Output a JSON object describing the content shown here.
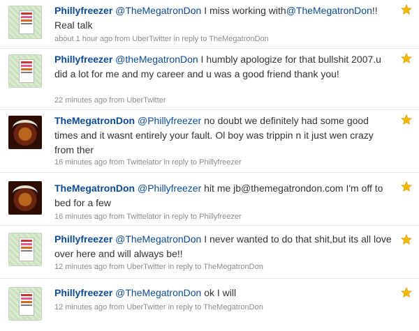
{
  "colors": {
    "link": "#0b4a94",
    "text": "#333333",
    "meta": "#8a8a8a",
    "star": "#f5b800"
  },
  "tweets": [
    {
      "user": "Phillyfreezer",
      "avatar": "phillyfreezer-avatar",
      "mention": "@TheMegatronDon",
      "text": " I miss working with",
      "mention2": "@TheMegatronDon",
      "text2": "!! Real talk",
      "time": "about 1 hour ago",
      "from": "from",
      "client": "UberTwitter",
      "reply_prefix": "in reply to",
      "reply_to": "TheMegatronDon"
    },
    {
      "user": "Phillyfreezer",
      "avatar": "phillyfreezer-avatar",
      "mention": "@theMegatronDon",
      "text": " I humbly apologize for that bullshit 2007.u did a lot for me and my career and u was a good friend thank you!",
      "time": "22 minutes ago",
      "from": "from",
      "client": "UberTwitter"
    },
    {
      "user": "TheMegatronDon",
      "avatar": "megatrondon-avatar",
      "mention": "@Phillyfreezer",
      "text": " no doubt we definitely had some good times and it wasnt entirely your fault. Ol boy was trippin n it just wen crazy from ther",
      "time": "16 minutes ago",
      "from": "from",
      "client": "Twittelator",
      "reply_prefix": "in reply to",
      "reply_to": "Phillyfreezer"
    },
    {
      "user": "TheMegatronDon",
      "avatar": "megatrondon-avatar",
      "mention": "@Phillyfreezer",
      "text": " hit me jb@themegatrondon.com I'm off to bed for a few",
      "time": "16 minutes ago",
      "from": "from",
      "client": "Twittelator",
      "reply_prefix": "in reply to",
      "reply_to": "Phillyfreezer"
    },
    {
      "user": "Phillyfreezer",
      "avatar": "phillyfreezer-avatar",
      "mention": "@TheMegatronDon",
      "text": " I never wanted to do that shit,but its all love over here and will always be!!",
      "time": "12 minutes ago",
      "from": "from",
      "client": "UberTwitter",
      "reply_prefix": "in reply to",
      "reply_to": "TheMegatronDon"
    },
    {
      "user": "Phillyfreezer",
      "avatar": "phillyfreezer-avatar",
      "mention": "@TheMegatronDon",
      "text": " ok I will",
      "time": "12 minutes ago",
      "from": "from",
      "client": "UberTwitter",
      "reply_prefix": "in reply to",
      "reply_to": "TheMegatronDon"
    }
  ]
}
